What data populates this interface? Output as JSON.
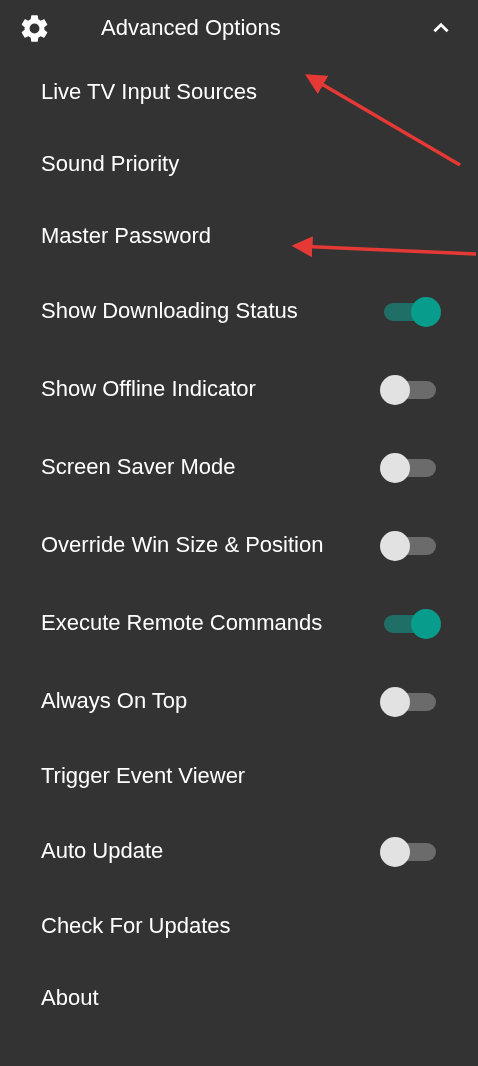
{
  "header": {
    "title": "Advanced Options",
    "expanded": true
  },
  "items": [
    {
      "kind": "link",
      "label": "Live TV Input Sources"
    },
    {
      "kind": "link",
      "label": "Sound Priority"
    },
    {
      "kind": "link",
      "label": "Master Password"
    },
    {
      "kind": "toggle",
      "label": "Show Downloading Status",
      "on": true
    },
    {
      "kind": "toggle",
      "label": "Show Offline Indicator",
      "on": false
    },
    {
      "kind": "toggle",
      "label": "Screen Saver Mode",
      "on": false
    },
    {
      "kind": "toggle",
      "label": "Override Win Size & Position",
      "on": false
    },
    {
      "kind": "toggle",
      "label": "Execute Remote Commands",
      "on": true
    },
    {
      "kind": "toggle",
      "label": "Always On Top",
      "on": false
    },
    {
      "kind": "link",
      "label": "Trigger Event Viewer"
    },
    {
      "kind": "toggle",
      "label": "Auto Update",
      "on": false
    },
    {
      "kind": "link",
      "label": "Check For Updates"
    },
    {
      "kind": "link",
      "label": "About"
    }
  ]
}
